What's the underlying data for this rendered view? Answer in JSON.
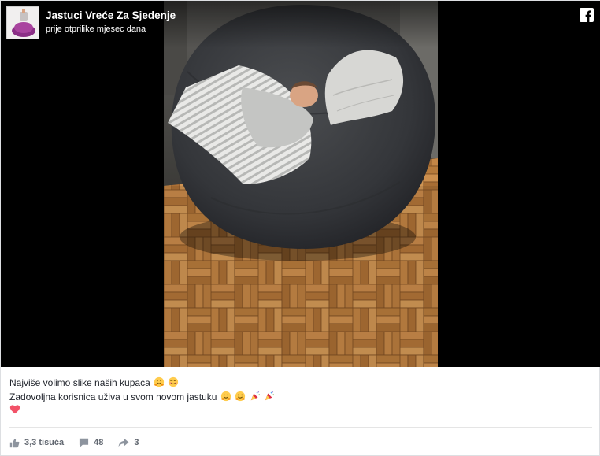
{
  "header": {
    "page_name": "Jastuci Vreće Za Sjedenje",
    "timestamp": "prije otprilike mjesec dana",
    "icons": {
      "avatar": "bean-bag-logo",
      "platform": "facebook-icon"
    }
  },
  "media": {
    "image": "bean-bag-photo"
  },
  "caption": {
    "line1": "Najviše volimo slike naših kupaca",
    "line2": "Zadovoljna korisnica uživa u svom novom jastuku",
    "line1_emojis": [
      "hugging-face-icon",
      "smiling-face-icon"
    ],
    "line2_emojis": [
      "hugging-face-icon",
      "hugging-face-icon",
      "party-popper-icon",
      "party-popper-icon"
    ],
    "line3_emojis": [
      "heart-icon"
    ]
  },
  "footer": {
    "likes": "3,3 tisuća",
    "comments": "48",
    "shares": "3"
  },
  "colors": {
    "text": "#1d2129",
    "muted": "#616770",
    "heart": "#f25268"
  }
}
